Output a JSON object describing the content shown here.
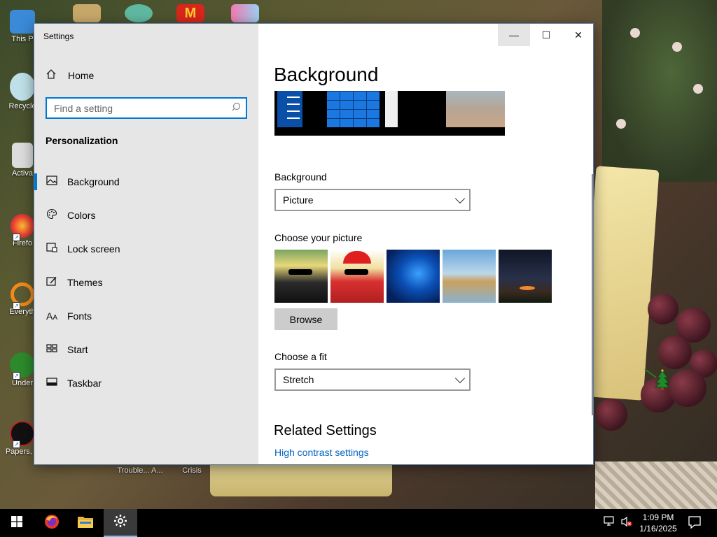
{
  "desktop": {
    "icons": [
      {
        "label": "This P"
      },
      {
        "label": "Recycle"
      },
      {
        "label": "Activa"
      },
      {
        "label": "Firefo"
      },
      {
        "label": "Everyth"
      },
      {
        "label": "Under"
      },
      {
        "label": "Papers, P"
      }
    ],
    "bottom_labels": [
      "Trouble... A...",
      "Crisis"
    ]
  },
  "window": {
    "title": "Settings",
    "controls": {
      "minimize": "—",
      "maximize": "☐",
      "close": "✕"
    }
  },
  "sidebar": {
    "home_label": "Home",
    "search_placeholder": "Find a setting",
    "section_title": "Personalization",
    "items": [
      {
        "label": "Background",
        "icon": "picture-icon"
      },
      {
        "label": "Colors",
        "icon": "palette-icon"
      },
      {
        "label": "Lock screen",
        "icon": "lock-screen-icon"
      },
      {
        "label": "Themes",
        "icon": "themes-icon"
      },
      {
        "label": "Fonts",
        "icon": "fonts-icon"
      },
      {
        "label": "Start",
        "icon": "start-icon"
      },
      {
        "label": "Taskbar",
        "icon": "taskbar-icon"
      }
    ],
    "active_index": 0
  },
  "main": {
    "page_title": "Background",
    "background_label": "Background",
    "background_value": "Picture",
    "choose_picture_label": "Choose your picture",
    "browse_label": "Browse",
    "choose_fit_label": "Choose a fit",
    "fit_value": "Stretch",
    "related_title": "Related Settings",
    "high_contrast_link": "High contrast settings"
  },
  "taskbar": {
    "time": "1:09 PM",
    "date": "1/16/2025",
    "accent": "#76b9ed"
  },
  "colors": {
    "accent": "#0078d7",
    "link": "#0067c0"
  }
}
